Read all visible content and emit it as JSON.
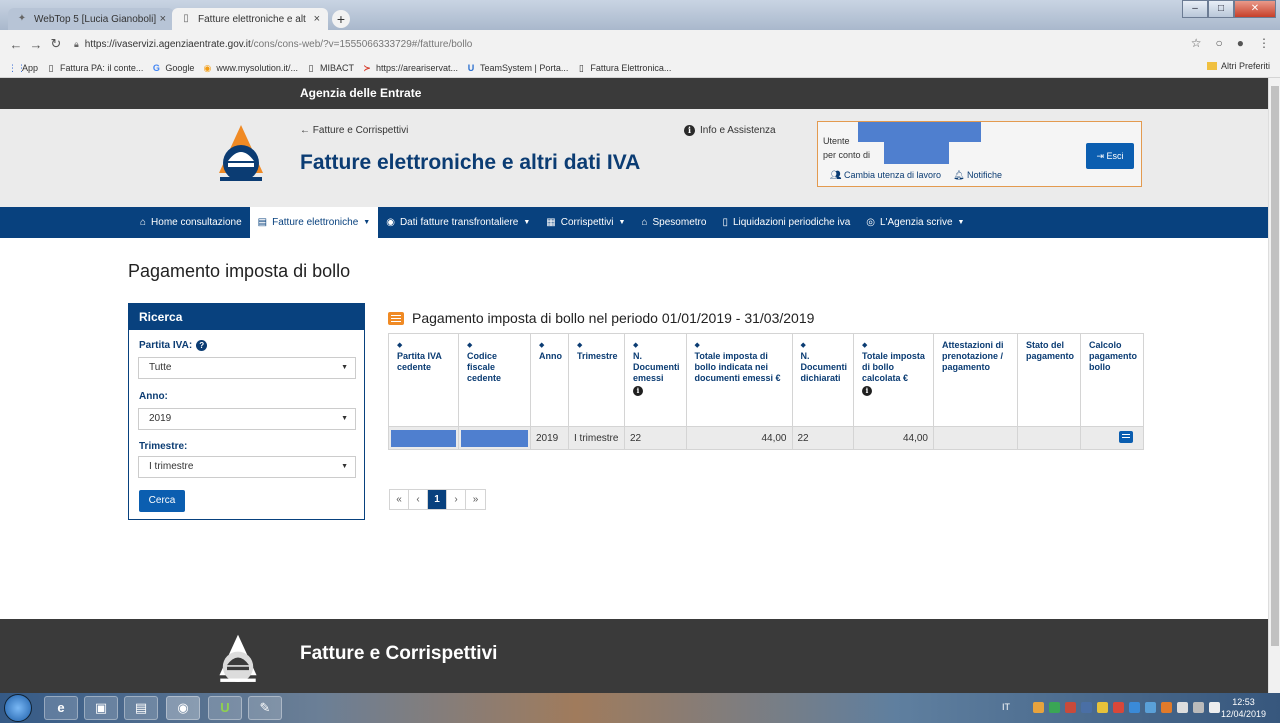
{
  "browser": {
    "tabs": [
      {
        "title": "WebTop 5 [Lucia Gianoboli]",
        "active": false
      },
      {
        "title": "Fatture elettroniche e altri dati IV",
        "active": true
      }
    ],
    "url_host": "https://ivaservizi.agenziaentrate.gov.it",
    "url_path": "/cons/cons-web/?v=1555066333729#/fatture/bollo",
    "bookmarks": [
      "App",
      "Fattura PA: il conte...",
      "Google",
      "www.mysolution.it/...",
      "MIBACT",
      "https://areariservat...",
      "TeamSystem | Porta...",
      "Fattura Elettronica..."
    ],
    "other_bookmarks": "Altri Preferiti"
  },
  "agency_bar": "Agenzia delle Entrate",
  "header": {
    "back_link": "← Fatture e Corrispettivi",
    "title": "Fatture elettroniche e altri dati IVA",
    "info_link": "Info e Assistenza",
    "user_label": "Utente",
    "on_behalf_label": "per conto di",
    "change_user": "Cambia utenza di lavoro",
    "notifications": "Notifiche",
    "exit": "Esci"
  },
  "nav": [
    {
      "label": "Home consultazione",
      "icon": "home-icon",
      "caret": false
    },
    {
      "label": "Fatture elettroniche",
      "icon": "document-icon",
      "caret": true,
      "active": true
    },
    {
      "label": "Dati fatture transfrontaliere",
      "icon": "globe-icon",
      "caret": true
    },
    {
      "label": "Corrispettivi",
      "icon": "calculator-icon",
      "caret": true
    },
    {
      "label": "Spesometro",
      "icon": "bank-icon",
      "caret": false
    },
    {
      "label": "Liquidazioni periodiche iva",
      "icon": "document-icon",
      "caret": false
    },
    {
      "label": "L'Agenzia scrive",
      "icon": "compass-icon",
      "caret": true
    }
  ],
  "page_title": "Pagamento imposta di bollo",
  "search": {
    "heading": "Ricerca",
    "partita_iva_label": "Partita IVA:",
    "partita_iva_value": "Tutte",
    "anno_label": "Anno:",
    "anno_value": "2019",
    "trimestre_label": "Trimestre:",
    "trimestre_value": "I trimestre",
    "button": "Cerca"
  },
  "table": {
    "title": "Pagamento imposta di bollo nel periodo 01/01/2019 - 31/03/2019",
    "columns": [
      "Partita IVA cedente",
      "Codice fiscale cedente",
      "Anno",
      "Trimestre",
      "N. Documenti emessi",
      "Totale imposta di bollo indicata nei documenti emessi €",
      "N. Documenti dichiarati",
      "Totale imposta di bollo calcolata €",
      "Attestazioni di prenotazione / pagamento",
      "Stato del pagamento",
      "Calcolo pagamento bollo"
    ],
    "rows": [
      {
        "anno": "2019",
        "trimestre": "I trimestre",
        "n_emessi": "22",
        "totale_indicata": "44,00",
        "n_dichiarati": "22",
        "totale_calcolata": "44,00",
        "attestazioni": "",
        "stato": ""
      }
    ]
  },
  "pager": {
    "first": "«",
    "prev": "‹",
    "current": "1",
    "next": "›",
    "last": "»"
  },
  "footer_title": "Fatture e Corrispettivi",
  "taskbar": {
    "lang": "IT",
    "time": "12:53",
    "date": "12/04/2019"
  },
  "colors": {
    "primary": "#08417e",
    "button": "#0b5eb0",
    "accent": "#f08a24",
    "redaction": "#4f7fcf"
  }
}
